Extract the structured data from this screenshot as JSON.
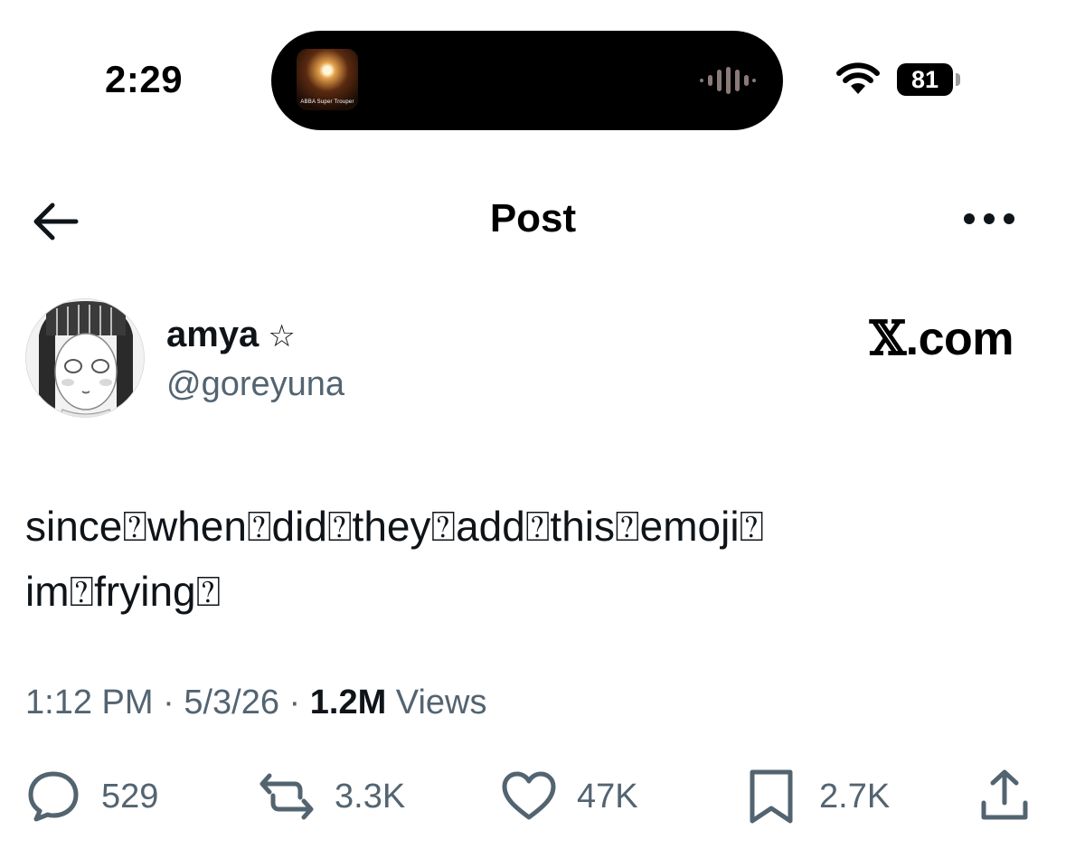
{
  "status_bar": {
    "time": "2:29",
    "now_playing_caption": "ABBA Super Trouper",
    "battery": "81",
    "icons": [
      "wifi-icon",
      "waveform-icon"
    ]
  },
  "header": {
    "title": "Post",
    "back_icon": "arrow-left-icon",
    "more_icon": "more-dots-icon"
  },
  "author": {
    "display_name": "amya",
    "badge": "☆",
    "handle": "@goreyuna"
  },
  "watermark": ".com",
  "tweet": {
    "text": "since⍰when⍰did⍰they⍰add⍰this⍰emoji⍰\nim⍰frying⍰"
  },
  "meta": {
    "time": "1:12 PM",
    "date": "5/3/26",
    "views_count": "1.2M",
    "views_label": "Views"
  },
  "actions": {
    "replies": "529",
    "reposts": "3.3K",
    "likes": "47K",
    "bookmarks": "2.7K"
  },
  "colors": {
    "text": "#0f1419",
    "secondary": "#536471",
    "background": "#ffffff"
  }
}
